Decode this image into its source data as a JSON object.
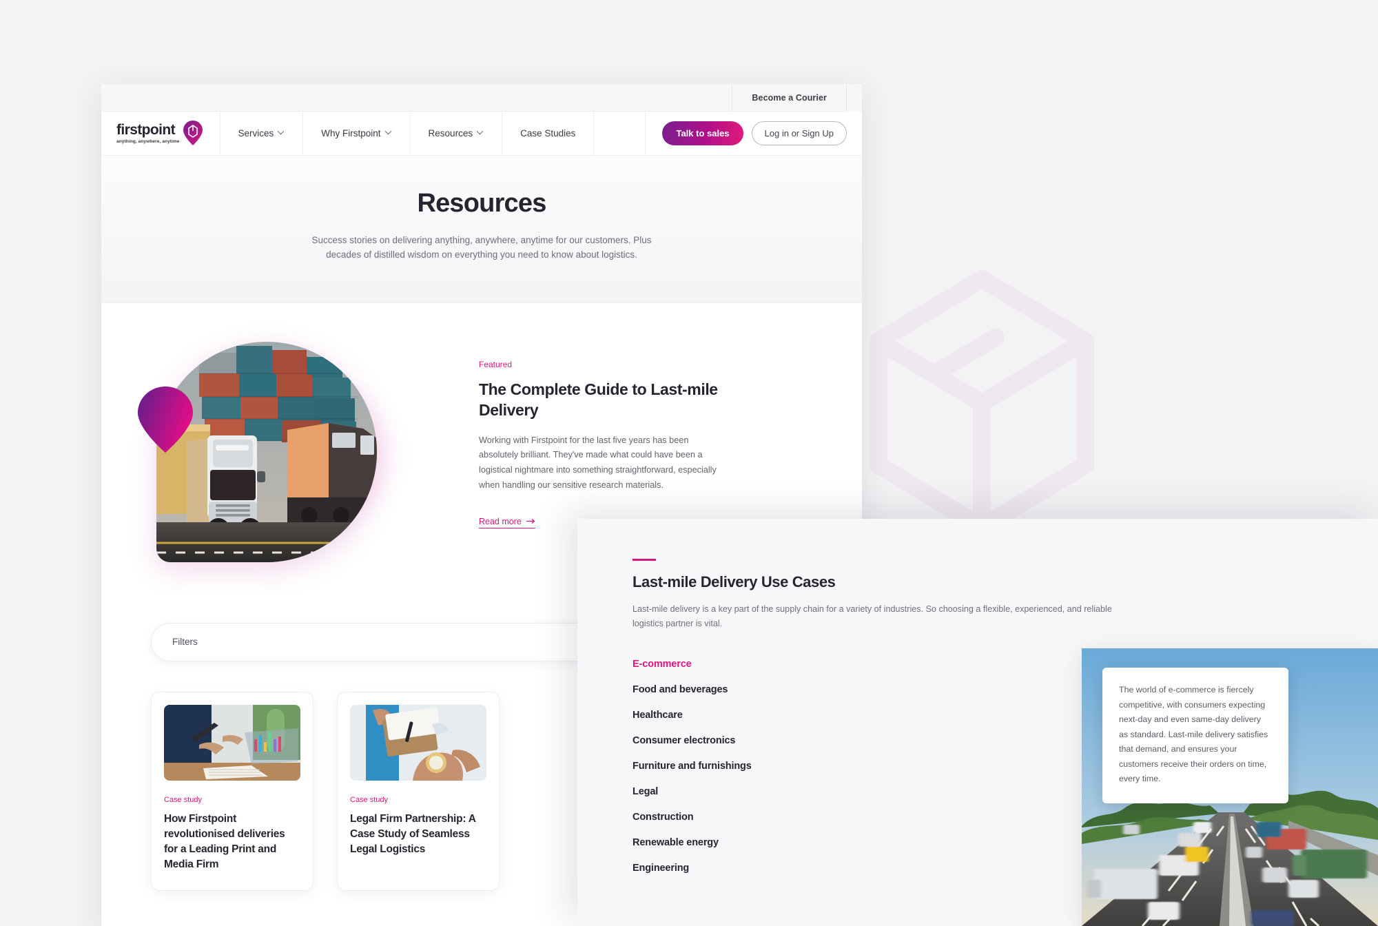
{
  "brand": {
    "name": "firstpoint",
    "tagline": "anything, anywhere, anytime",
    "accent_pink": "#d4187f",
    "accent_magenta": "#e0137f",
    "accent_purple": "#7a1f8f"
  },
  "topbar": {
    "courier_link": "Become a Courier"
  },
  "nav": {
    "items": [
      {
        "label": "Services",
        "has_chevron": true
      },
      {
        "label": "Why Firstpoint",
        "has_chevron": true
      },
      {
        "label": "Resources",
        "has_chevron": true
      },
      {
        "label": "Case Studies",
        "has_chevron": false
      }
    ],
    "primary_cta": "Talk to sales",
    "secondary_cta": "Log in or Sign Up"
  },
  "hero": {
    "title": "Resources",
    "subtitle": "Success stories on delivering anything, anywhere, anytime for our customers. Plus decades of distilled wisdom on everything you need to know about logistics."
  },
  "featured": {
    "tag": "Featured",
    "title": "The Complete Guide to Last-mile Delivery",
    "body": "Working with Firstpoint for the last five years has been absolutely brilliant. They've made what could have been a logistical nightmare into something straightforward, especially when handling our sensitive research materials.",
    "read_more": "Read more",
    "image_alt": "freight-truck-and-train-with-shipping-containers"
  },
  "filters": {
    "label": "Filters"
  },
  "cards": [
    {
      "tag": "Case study",
      "title": "How Firstpoint revolutionised deliveries for a Leading Print and Media Firm",
      "image_alt": "person-working-on-laptop-with-data-overlay"
    },
    {
      "tag": "Case study",
      "title": "Legal Firm Partnership: A Case Study of Seamless Legal Logistics",
      "image_alt": "courier-handing-over-parcel-checking-watch"
    }
  ],
  "use_cases": {
    "title": "Last-mile Delivery Use Cases",
    "subtitle": "Last-mile delivery is a key part of the supply chain for a variety of industries. So choosing a flexible, experienced, and reliable logistics partner is vital.",
    "items": [
      {
        "label": "E-commerce",
        "active": true
      },
      {
        "label": "Food and beverages",
        "active": false
      },
      {
        "label": "Healthcare",
        "active": false
      },
      {
        "label": "Consumer electronics",
        "active": false
      },
      {
        "label": "Furniture and furnishings",
        "active": false
      },
      {
        "label": "Legal",
        "active": false
      },
      {
        "label": "Construction",
        "active": false
      },
      {
        "label": "Renewable energy",
        "active": false
      },
      {
        "label": "Engineering",
        "active": false
      }
    ],
    "detail_text": "The world of e-commerce is fiercely competitive, with consumers expecting next-day and even same-day delivery as standard. Last-mile delivery satisfies that demand, and ensures your customers receive their orders on time, every time.",
    "media_alt": "motorway-with-motion-blurred-lorries-at-dusk"
  }
}
